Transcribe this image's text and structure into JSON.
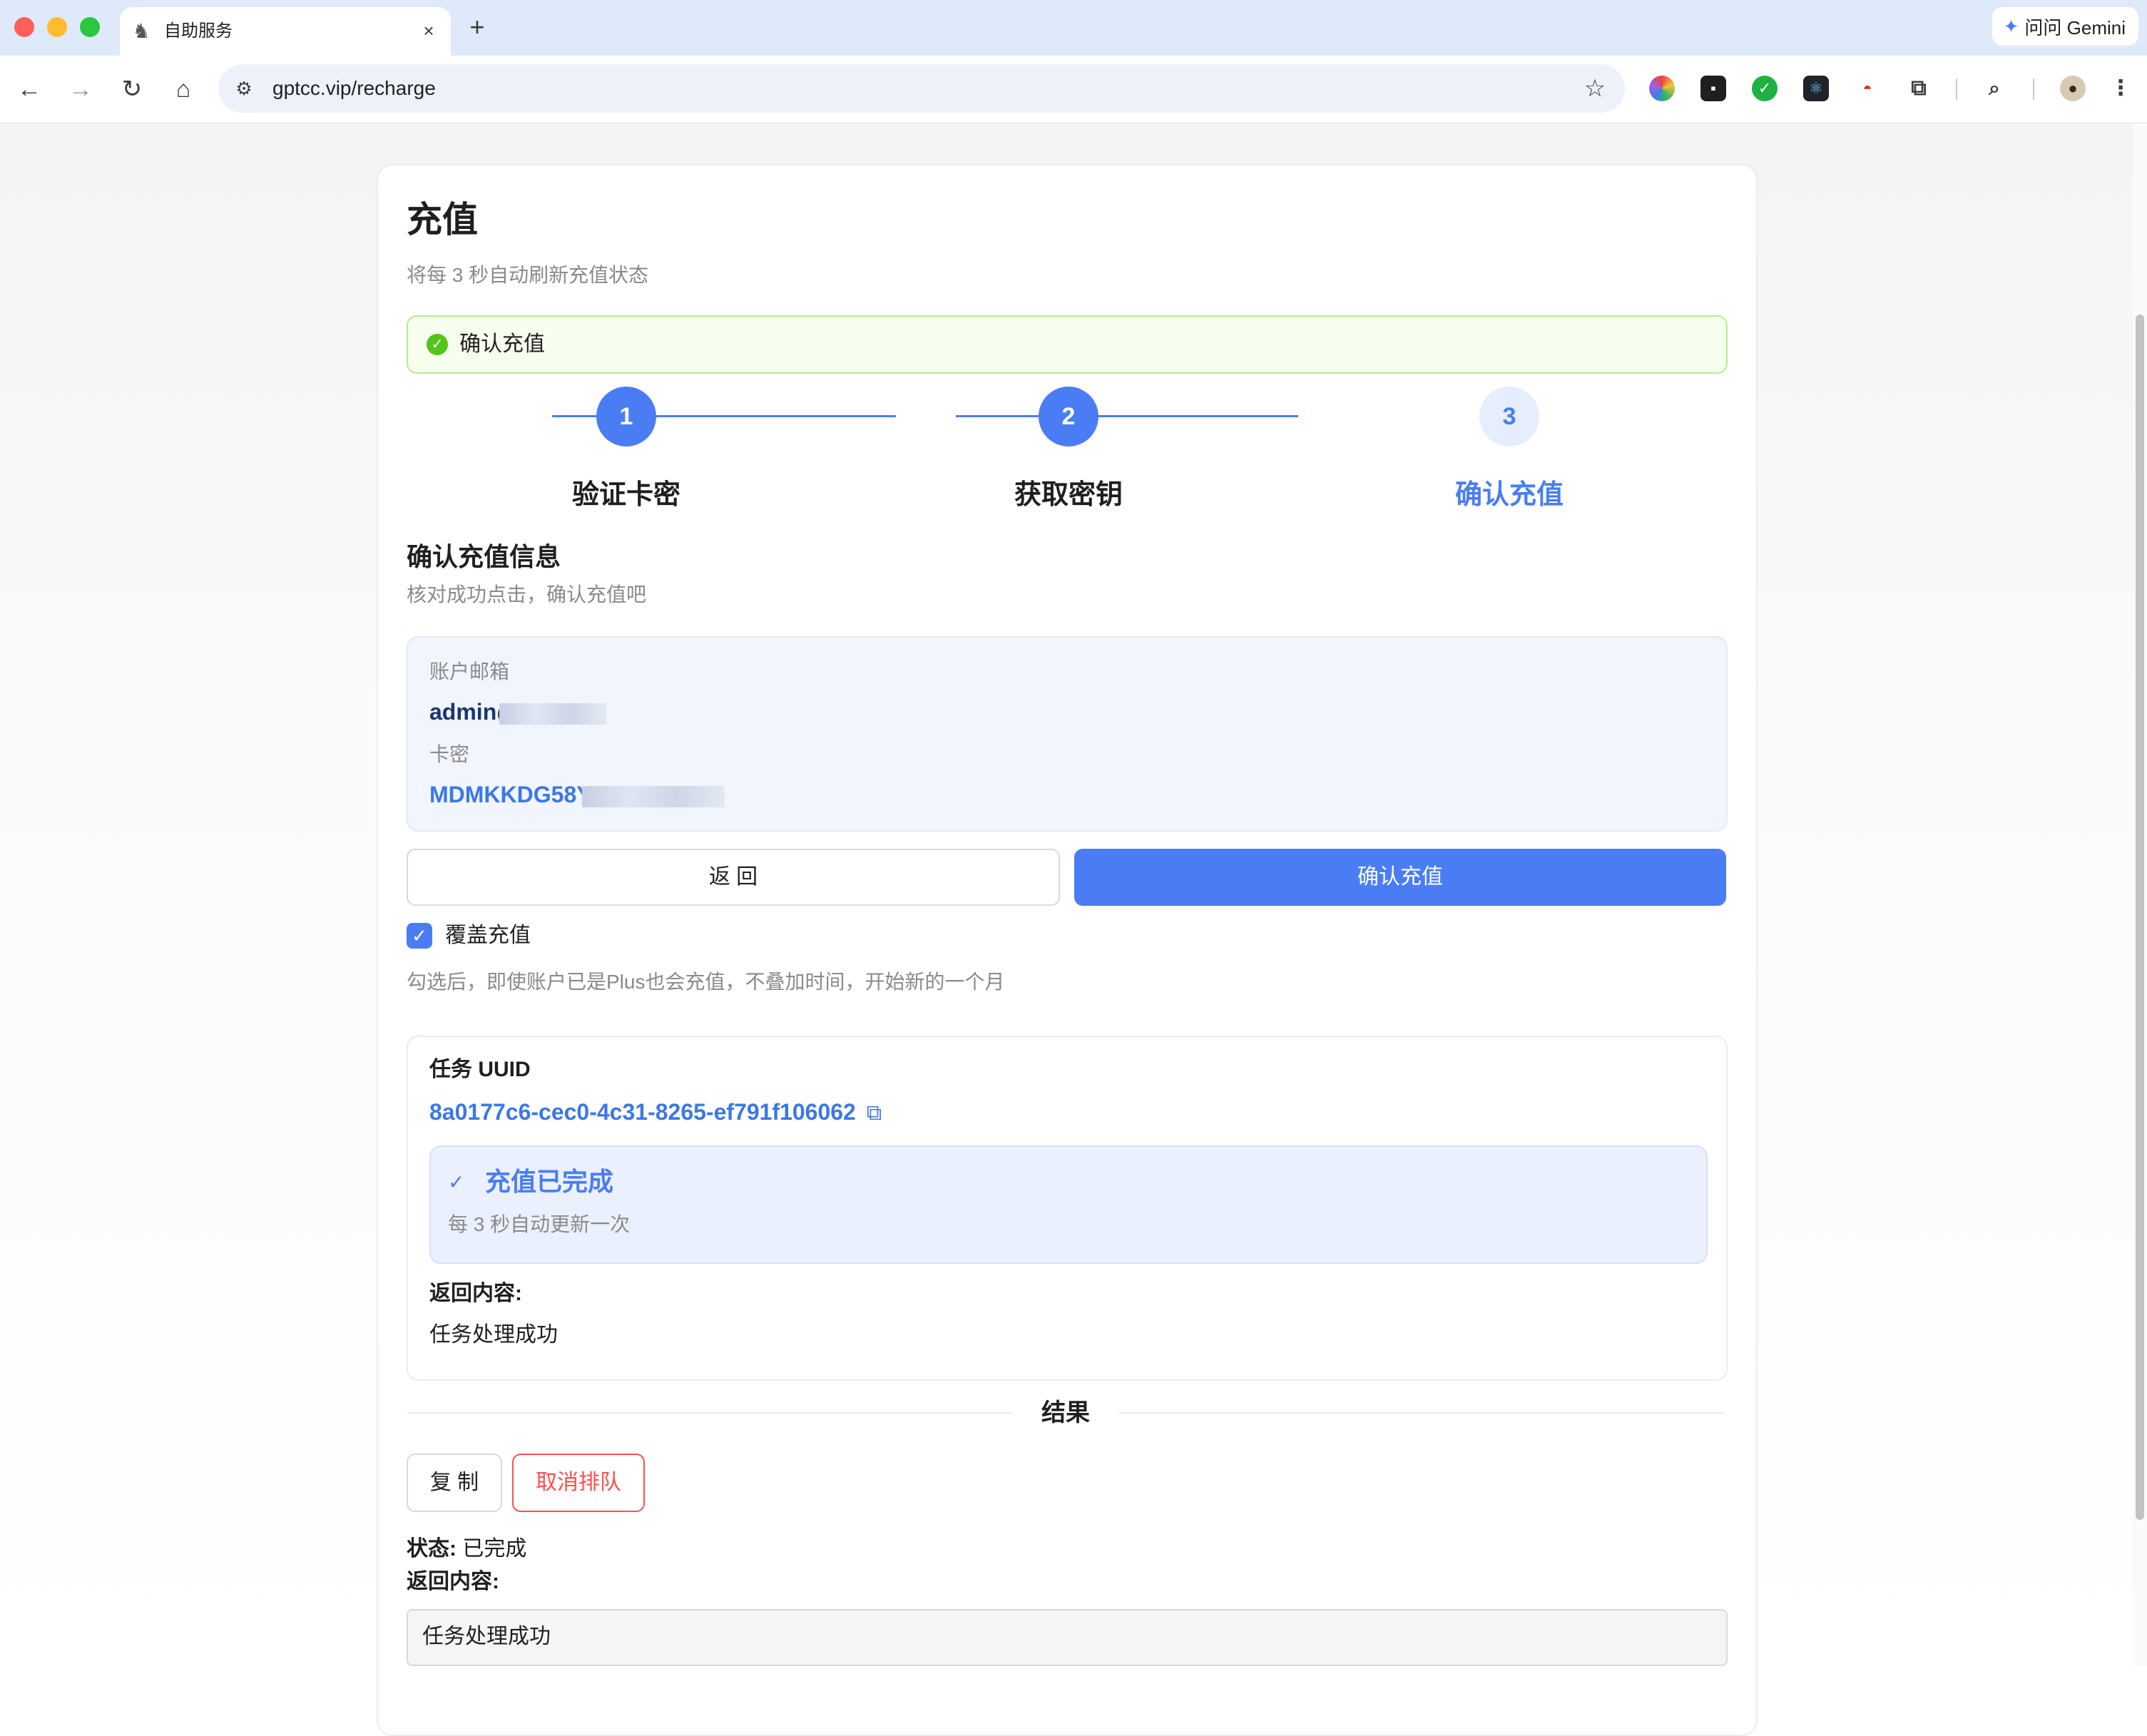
{
  "browser": {
    "tab_title": "自助服务",
    "tab_favicon": "wolf-icon",
    "new_tab": "+",
    "gemini_label": "问问 Gemini",
    "url": "gptcc.vip/recharge"
  },
  "page": {
    "title": "充值",
    "subtitle": "将每 3 秒自动刷新充值状态",
    "alert_text": "确认充值",
    "steps": [
      {
        "num": "1",
        "label": "验证卡密"
      },
      {
        "num": "2",
        "label": "获取密钥"
      },
      {
        "num": "3",
        "label": "确认充值"
      }
    ],
    "section_title": "确认充值信息",
    "section_subtitle": "核对成功点击，确认充值吧",
    "info": {
      "email_label": "账户邮箱",
      "email_value": "admin@",
      "card_label": "卡密",
      "card_value": "MDMKKDG58Y"
    },
    "buttons": {
      "back": "返 回",
      "confirm": "确认充值"
    },
    "override": {
      "label": "覆盖充值",
      "checked": true,
      "hint": "勾选后，即使账户已是Plus也会充值，不叠加时间，开始新的一个月"
    },
    "task": {
      "title": "任务 UUID",
      "uuid": "8a0177c6-cec0-4c31-8265-ef791f106062",
      "status_title": "充值已完成",
      "status_sub": "每 3 秒自动更新一次",
      "return_label": "返回内容:",
      "return_value": "任务处理成功"
    },
    "result": {
      "divider": "结果",
      "copy": "复 制",
      "cancel": "取消排队",
      "state_label": "状态:",
      "state_value": "已完成",
      "return_label": "返回内容:",
      "return_value": "任务处理成功"
    }
  },
  "colors": {
    "primary": "#4a7df4",
    "success": "#52c41a",
    "danger": "#ff4d4f"
  }
}
